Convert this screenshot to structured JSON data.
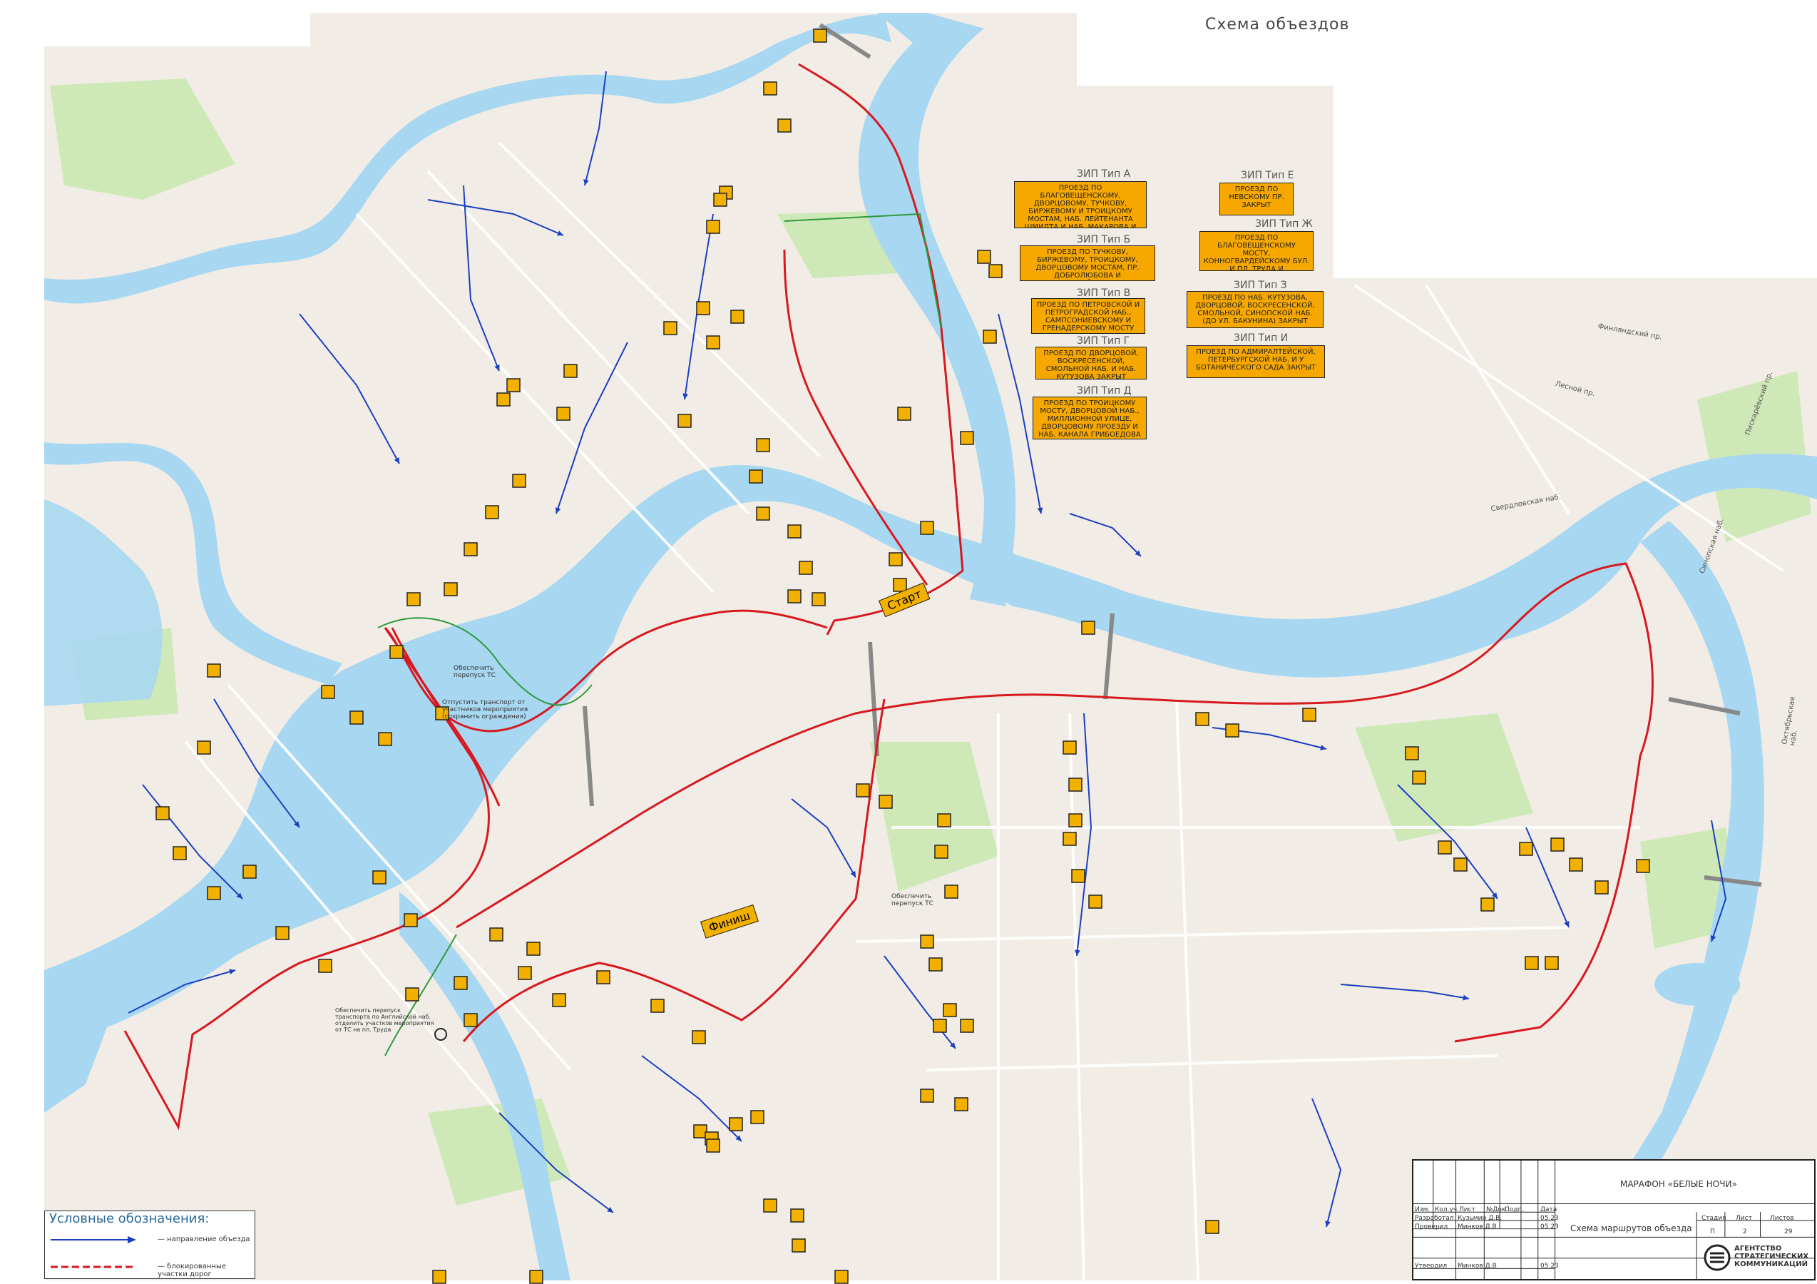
{
  "map": {
    "title": "Схема объездов",
    "start_label": "Старт",
    "finish_label": "Финиш",
    "notes": {
      "transport_note_1": "Обеспечить перепуск ТС",
      "transport_note_2": "Отпустить транспорт от участников мероприятия (сохранить ограждения)",
      "transport_note_3": "Обеспечить перепуск ТС",
      "transport_note_4": "Обеспечить перепуск транспорта по Английской наб. отделить участков мероприятия от ТС на пл. Труда"
    },
    "zip_labels": [
      "ЗИП Тип А",
      "ЗИП Тип Б",
      "ЗИП Тип В",
      "ЗИП Тип Г",
      "ЗИП Тип Д",
      "ЗИП Тип Е",
      "ЗИП Тип Ж",
      "ЗИП Тип З",
      "ЗИП Тип И"
    ],
    "notices": [
      "Проезд по Благовещенскому, Дворцовому, Тучкову, Биржевому и Троицкому мостам, наб. Лейтенанта Шмидта и наб. Макарова и участку Кадетской линии закрыт",
      "Проезд по Тучкову, Биржевому, Троицкому, Дворцовому мостам, пр. Добролюбова и Кронверкской наб. закрыт",
      "Проезд по Петровской и Петроградской наб., Сампсониевскому и Гренадерскому мосту закрыт",
      "Проезд по Дворцовой, Воскресенской, Смольной наб. и наб. Кутузова закрыт",
      "Проезд по Троицкому мосту, Дворцовой наб., Миллионной улице, Дворцовому проезду и наб. канала Грибоедова закрыт",
      "Проезд по Невскому пр. закрыт",
      "Проезд по Благовещенскому мосту, Конногвардейскому бул. и пл. Труда и Адмиралтейскому пр. закрыт",
      "Проезд по наб. Кутузова, Дворцовой, Воскресенской, Смольной, Синопской наб. (до ул. Бакунина) закрыт",
      "Проезд по Адмиралтейской, Петербургской наб. и у Ботанического сада закрыт"
    ],
    "place_labels": [
      "Свердловская наб.",
      "Синопская наб.",
      "Октябрьская наб.",
      "Пискарёвский пр.",
      "Лесной пр.",
      "Финляндский пр."
    ]
  },
  "legend": {
    "title": "Условные обозначения:",
    "row1_label": "— направление объезда",
    "row2_label": "— блокированные участки дорог"
  },
  "stamp": {
    "project": "МАРАФОН «БЕЛЫЕ НОЧИ»",
    "sheet_title": "Схема маршрутов объезда",
    "header_cells": [
      "Изм.",
      "Кол.уч.",
      "Лист",
      "№Док.",
      "Подп.",
      "Дата"
    ],
    "rows": [
      {
        "role": "Разработал",
        "name": "Кузьмин Д.В.",
        "date": "05.23"
      },
      {
        "role": "Проверил",
        "name": "Минков Д.В.",
        "date": "05.23"
      },
      {
        "role": "Утвердил",
        "name": "Минков Д.В.",
        "date": "05.23"
      }
    ],
    "stage_header": "Стадия",
    "sheet_header": "Лист",
    "sheets_header": "Листов",
    "stage": "П",
    "sheet": "2",
    "sheets": "29",
    "company": "АГЕНТСТВО СТРАТЕГИЧЕСКИХ КОММУНИКАЦИЙ"
  },
  "colors": {
    "water": "#a7d7f1",
    "land": "#f1ede6",
    "park": "#cfe8b8",
    "route": "#d71920",
    "detour": "#1d3fbf",
    "sign": "#f2b000"
  }
}
